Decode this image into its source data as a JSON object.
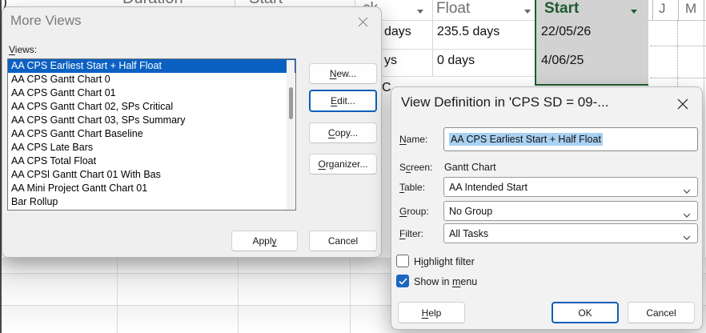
{
  "background": {
    "corner_glyph": ")",
    "left_headers": {
      "col1": "Duration",
      "col2": "Start"
    },
    "table": {
      "col1_header_fragment": "ck",
      "col2_header": "Float",
      "col3_header": "Start",
      "rows": [
        {
          "col1": "days",
          "col2": "235.5 days",
          "col3": "22/05/26"
        },
        {
          "col1": "ys",
          "col2": "0 days",
          "col3": "4/06/25"
        },
        {
          "col1": "C",
          "col2": "",
          "col3": ""
        }
      ]
    },
    "timeline": {
      "labels": [
        "J",
        "M"
      ]
    },
    "colors": {
      "selected_column_bg": "#d2d2d2",
      "selected_column_accent_green": "#1e5b2f"
    }
  },
  "more_views": {
    "title": "More Views",
    "views_label": {
      "pre": "",
      "accel": "V",
      "post": "iews:"
    },
    "items": [
      "AA CPS Earliest Start + Half Float",
      "AA CPS Gantt Chart 0",
      "AA CPS Gantt Chart 01",
      "AA CPS Gantt Chart 02, SPs Critical",
      "AA CPS Gantt Chart 03, SPs Summary",
      "AA CPS Gantt Chart Baseline",
      "AA CPS Late Bars",
      "AA CPS Total Float",
      "AA CPSl Gantt Chart 01 With Bas",
      "AA Mini Project Gantt Chart 01",
      "Bar Rollup"
    ],
    "selected_index": 0,
    "selection_color": "#0b61c2",
    "buttons": {
      "new": {
        "pre": "",
        "accel": "N",
        "post": "ew..."
      },
      "edit": {
        "pre": "",
        "accel": "E",
        "post": "dit..."
      },
      "copy": {
        "pre": "",
        "accel": "C",
        "post": "opy..."
      },
      "organizer": {
        "pre": "",
        "accel": "O",
        "post": "rganizer..."
      },
      "apply": {
        "pre": "Appl",
        "accel": "y",
        "post": ""
      },
      "cancel": {
        "pre": "Cancel",
        "accel": "",
        "post": ""
      }
    }
  },
  "view_definition": {
    "title": "View Definition in 'CPS SD = 09-...",
    "accent_color": "#0b5fb8",
    "fields": {
      "name": {
        "label": {
          "pre": "",
          "accel": "N",
          "post": "ame:"
        },
        "value": "AA CPS Earliest Start + Half Float",
        "selection_bg": "#a9d1f2"
      },
      "screen": {
        "label": {
          "pre": "S",
          "accel": "c",
          "post": "reen:"
        },
        "value": "Gantt Chart"
      },
      "table": {
        "label": {
          "pre": "",
          "accel": "T",
          "post": "able:"
        },
        "value": "AA Intended Start"
      },
      "group": {
        "label": {
          "pre": "",
          "accel": "G",
          "post": "roup:"
        },
        "value": "No Group"
      },
      "filter": {
        "label": {
          "pre": "",
          "accel": "F",
          "post": "ilter:"
        },
        "value": "All Tasks"
      }
    },
    "checkboxes": {
      "highlight": {
        "label": {
          "pre": "H",
          "accel": "i",
          "post": "ghlight filter"
        },
        "checked": false
      },
      "show_in_menu": {
        "label": {
          "pre": "Show in ",
          "accel": "m",
          "post": "enu"
        },
        "checked": true
      }
    },
    "buttons": {
      "help": {
        "pre": "",
        "accel": "H",
        "post": "elp"
      },
      "ok": {
        "pre": "OK",
        "accel": "",
        "post": ""
      },
      "cancel": {
        "pre": "Cancel",
        "accel": "",
        "post": ""
      }
    }
  }
}
